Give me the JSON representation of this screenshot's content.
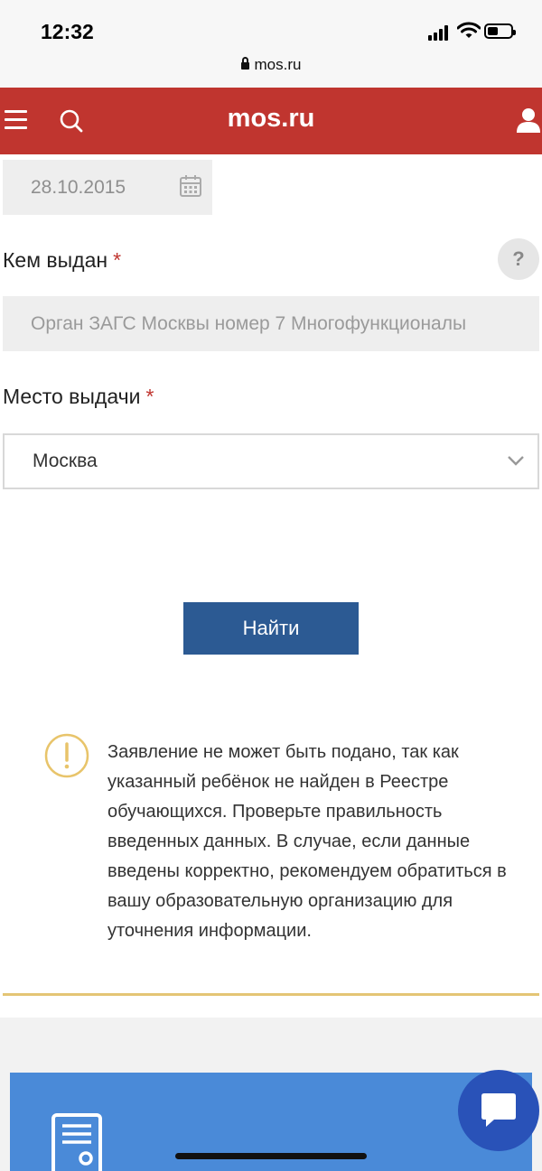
{
  "status_bar": {
    "time": "12:32",
    "url": "mos.ru"
  },
  "header": {
    "logo": "mos.ru",
    "color": "#c0352f"
  },
  "date_field": {
    "value": "28.10.2015"
  },
  "issued_by": {
    "label": "Кем выдан",
    "required_mark": "*",
    "help": "?",
    "value": "Орган ЗАГС Москвы номер 7 Многофункционалы"
  },
  "place_of_issue": {
    "label": "Место выдачи",
    "required_mark": "*",
    "selected": "Москва"
  },
  "find_button": {
    "label": "Найти",
    "color": "#2c5a93"
  },
  "warning": {
    "icon": "exclamation-icon",
    "text": "Заявление не может быть подано, так как указанный ребёнок не найден в Реестре обучающихся. Проверьте правильность введенных данных. В случае, если данные введены корректно, рекомендуем обратиться в вашу образовательную организацию для уточнения информации."
  }
}
